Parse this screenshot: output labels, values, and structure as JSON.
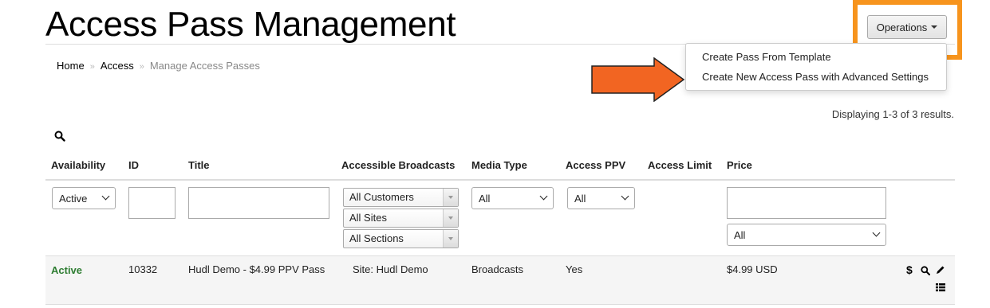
{
  "page": {
    "title": "Access Pass Management"
  },
  "breadcrumb": {
    "home": "Home",
    "sep": "»",
    "access": "Access",
    "current": "Manage Access Passes"
  },
  "operations": {
    "label": "Operations",
    "menu": [
      "Create Pass From Template",
      "Create New Access Pass with Advanced Settings"
    ]
  },
  "summary": "Displaying 1-3 of 3 results.",
  "columns": [
    "Availability",
    "ID",
    "Title",
    "Accessible Broadcasts",
    "Media Type",
    "Access PPV",
    "Access Limit",
    "Price"
  ],
  "filters": {
    "availability": "Active",
    "id": "",
    "title": "",
    "customers": "All Customers",
    "sites": "All Sites",
    "sections": "All Sections",
    "media_type": "All",
    "access_ppv": "All",
    "price": "",
    "price_select": "All"
  },
  "rows": [
    {
      "availability": "Active",
      "id": "10332",
      "title": "Hudl Demo - $4.99 PPV Pass",
      "broadcasts": "Site: Hudl Demo",
      "media_type": "Broadcasts",
      "access_ppv": "Yes",
      "access_limit": "",
      "price": "$4.99 USD"
    }
  ],
  "colors": {
    "highlight": "#f7941d",
    "arrow": "#f26522",
    "active": "#2e7d32"
  }
}
